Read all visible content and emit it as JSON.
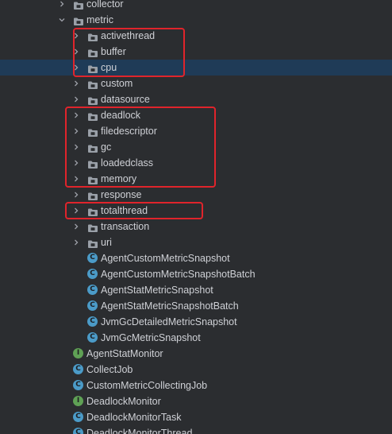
{
  "tree": {
    "rows": [
      {
        "label": "collector",
        "kind": "folder",
        "level": 1,
        "expanded": false
      },
      {
        "label": "metric",
        "kind": "folder",
        "level": 1,
        "expanded": true
      },
      {
        "label": "activethread",
        "kind": "folder",
        "level": 2,
        "expanded": false
      },
      {
        "label": "buffer",
        "kind": "folder",
        "level": 2,
        "expanded": false
      },
      {
        "label": "cpu",
        "kind": "folder",
        "level": 2,
        "expanded": false,
        "selected": true
      },
      {
        "label": "custom",
        "kind": "folder",
        "level": 2,
        "expanded": false
      },
      {
        "label": "datasource",
        "kind": "folder",
        "level": 2,
        "expanded": false
      },
      {
        "label": "deadlock",
        "kind": "folder",
        "level": 2,
        "expanded": false
      },
      {
        "label": "filedescriptor",
        "kind": "folder",
        "level": 2,
        "expanded": false
      },
      {
        "label": "gc",
        "kind": "folder",
        "level": 2,
        "expanded": false
      },
      {
        "label": "loadedclass",
        "kind": "folder",
        "level": 2,
        "expanded": false
      },
      {
        "label": "memory",
        "kind": "folder",
        "level": 2,
        "expanded": false
      },
      {
        "label": "response",
        "kind": "folder",
        "level": 2,
        "expanded": false
      },
      {
        "label": "totalthread",
        "kind": "folder",
        "level": 2,
        "expanded": false
      },
      {
        "label": "transaction",
        "kind": "folder",
        "level": 2,
        "expanded": false
      },
      {
        "label": "uri",
        "kind": "folder",
        "level": 2,
        "expanded": false
      },
      {
        "label": "AgentCustomMetricSnapshot",
        "kind": "class",
        "level": 2
      },
      {
        "label": "AgentCustomMetricSnapshotBatch",
        "kind": "class",
        "level": 2
      },
      {
        "label": "AgentStatMetricSnapshot",
        "kind": "class",
        "level": 2
      },
      {
        "label": "AgentStatMetricSnapshotBatch",
        "kind": "class",
        "level": 2
      },
      {
        "label": "JvmGcDetailedMetricSnapshot",
        "kind": "class",
        "level": 2
      },
      {
        "label": "JvmGcMetricSnapshot",
        "kind": "class",
        "level": 2
      },
      {
        "label": "AgentStatMonitor",
        "kind": "interface",
        "level": 1
      },
      {
        "label": "CollectJob",
        "kind": "class",
        "level": 1
      },
      {
        "label": "CustomMetricCollectingJob",
        "kind": "class",
        "level": 1
      },
      {
        "label": "DeadlockMonitor",
        "kind": "interface",
        "level": 1
      },
      {
        "label": "DeadlockMonitorTask",
        "kind": "class",
        "level": 1
      },
      {
        "label": "DeadlockMonitorThread",
        "kind": "class",
        "level": 1
      }
    ]
  },
  "icons": {
    "folder": "folder-icon",
    "class": "class-icon",
    "interface": "interface-icon",
    "collapsed": "chevron-right-icon",
    "expanded": "chevron-down-icon"
  },
  "colors": {
    "background": "#2b2d30",
    "selection": "#1f3b57",
    "text": "#cfd1d6",
    "class_icon": "#4b9bc8",
    "interface_icon": "#5fa155",
    "highlight_box": "#e0242b"
  },
  "class_glyph": "C",
  "interface_glyph": "I",
  "highlight_groups": [
    [
      "activethread",
      "buffer",
      "cpu"
    ],
    [
      "deadlock",
      "filedescriptor",
      "gc",
      "loadedclass",
      "memory"
    ],
    [
      "totalthread"
    ]
  ]
}
